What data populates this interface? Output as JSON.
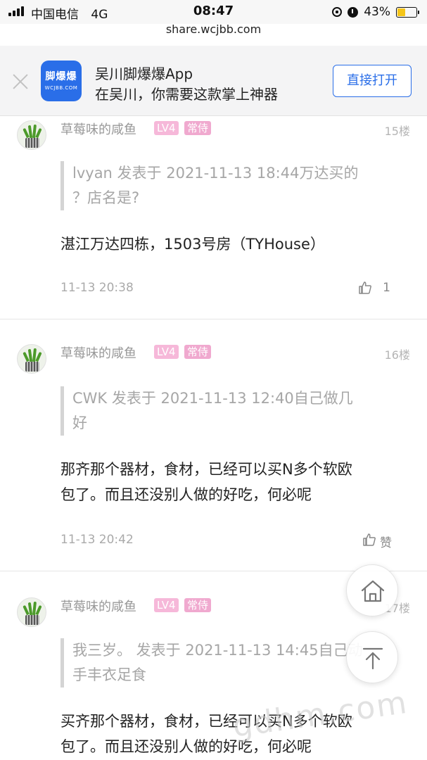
{
  "status_bar": {
    "carrier": "中国电信",
    "network": "4G",
    "time": "08:47",
    "battery_percent": "43%",
    "battery_level": 0.43,
    "url": "share.wcjbb.com"
  },
  "app_banner": {
    "logo_main": "脚爆爆",
    "logo_sub": "WCJBB.COM",
    "title": "吴川脚爆爆App",
    "subtitle": "在吴川，你需要这款掌上神器",
    "open_label": "直接打开",
    "accent": "#2a6ee8"
  },
  "comments": [
    {
      "username": "草莓味的咸鱼",
      "level": "LV4",
      "role": "常侍",
      "floor": "15楼",
      "quote_lines": [
        "lvyan 发表于 2021-11-13 18:44万达买的",
        "？店名是?"
      ],
      "body_lines": [
        "湛江万达四栋，1503号房（TYHouse）"
      ],
      "time": "11-13 20:38",
      "likes": "1"
    },
    {
      "username": "草莓味的咸鱼",
      "level": "LV4",
      "role": "常侍",
      "floor": "16楼",
      "quote_lines": [
        "CWK 发表于 2021-11-13 12:40自己做几",
        "好"
      ],
      "body_lines": [
        "那齐那个器材，食材，已经可以买N多个软欧",
        "包了。而且还没别人做的好吃，何必呢"
      ],
      "time": "11-13 20:42",
      "likes": "赞"
    },
    {
      "username": "草莓味的咸鱼",
      "level": "LV4",
      "role": "常侍",
      "floor": "17楼",
      "quote_lines": [
        "我三岁。 发表于 2021-11-13 14:45自己动",
        "手丰衣足食"
      ],
      "body_lines": [
        "买齐那个器材，食材，已经可以买N多个软欧",
        "包了。而且还没别人做的好吃，何必呢"
      ]
    }
  ],
  "fabs": {
    "home_icon": "home-icon",
    "top_icon": "back-to-top-icon"
  },
  "watermark": "gdhm.com"
}
